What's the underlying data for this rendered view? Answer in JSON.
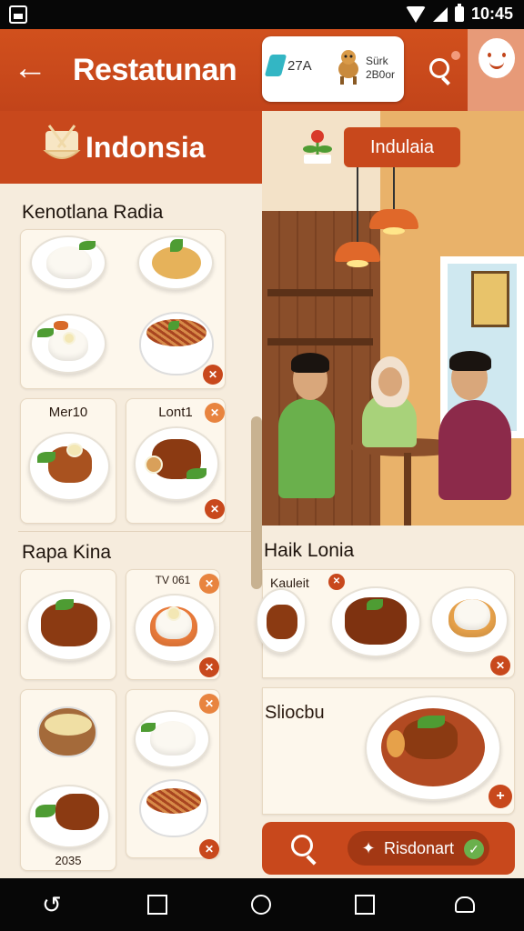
{
  "status_bar": {
    "time": "10:45"
  },
  "header": {
    "title": "Restatunan",
    "promo": {
      "left_text": "27A",
      "right_line1": "Sürk",
      "right_line2": "2B0or"
    }
  },
  "left": {
    "region_title": "Indonsia",
    "section1": {
      "title": "Kenotlana Radia",
      "card_labels": [
        "Mer10",
        "Lont1"
      ]
    },
    "section2": {
      "title": "Rapa Kina",
      "card_labels": [
        "TV 061",
        "2035"
      ]
    }
  },
  "right": {
    "tag": "Indulaia",
    "section": {
      "title": "Haik Lonia",
      "card_label": "Kauleit",
      "featured_title": "Sliocbu"
    },
    "bottom_bar": {
      "button_label": "Risdonart"
    }
  },
  "icons": {
    "back": "arrow-left-icon",
    "search": "search-icon",
    "profile": "face-avatar-icon",
    "nav": [
      "back-nav-icon",
      "recents-icon",
      "home-icon",
      "square-icon",
      "user-nav-icon"
    ]
  },
  "colors": {
    "primary": "#c8481c",
    "background": "#f6ecdd",
    "accent": "#e8843f"
  }
}
